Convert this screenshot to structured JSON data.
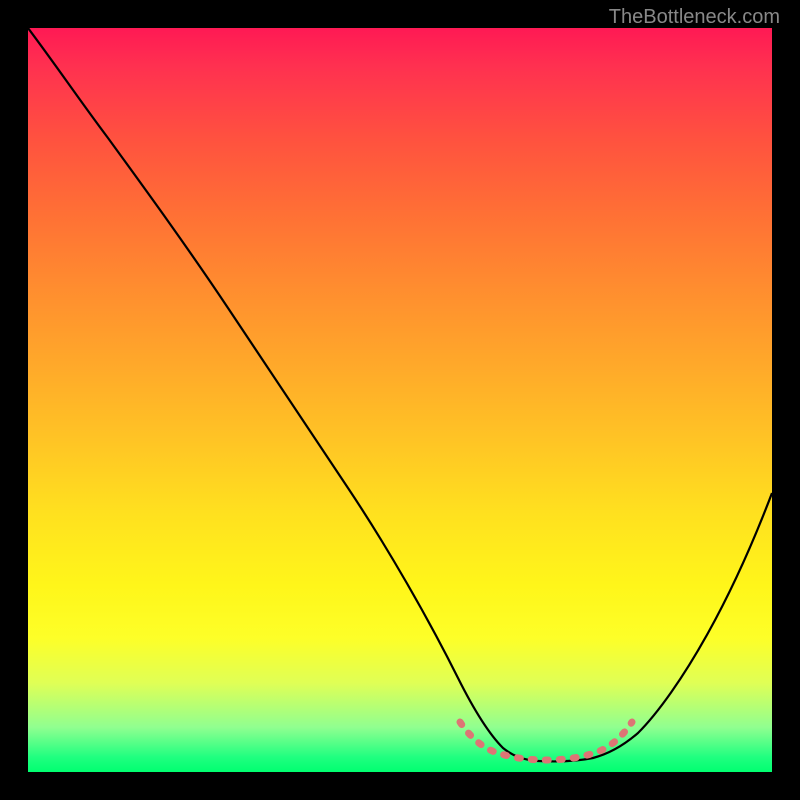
{
  "watermark": "TheBottleneck.com",
  "chart_data": {
    "type": "line",
    "title": "",
    "xlabel": "",
    "ylabel": "",
    "xlim": [
      0,
      100
    ],
    "ylim": [
      0,
      100
    ],
    "background_gradient": {
      "top_color": "#ff1954",
      "bottom_color": "#00ff70",
      "description": "red to green vertical gradient"
    },
    "series": [
      {
        "name": "bottleneck-curve",
        "color": "#000000",
        "x": [
          0,
          5,
          10,
          15,
          20,
          25,
          30,
          35,
          40,
          45,
          50,
          55,
          58,
          60,
          63,
          66,
          70,
          74,
          78,
          82,
          86,
          90,
          95,
          100
        ],
        "y": [
          100,
          94,
          88,
          82,
          76,
          69,
          62,
          55,
          48,
          40,
          32,
          22,
          14,
          8,
          4,
          2,
          1,
          1,
          2,
          4,
          9,
          16,
          26,
          40
        ]
      },
      {
        "name": "optimal-range-marker",
        "color": "#d87070",
        "x": [
          58,
          60,
          63,
          66,
          70,
          74,
          78,
          80
        ],
        "y": [
          5,
          3,
          2,
          2,
          2,
          2,
          3,
          5
        ]
      }
    ],
    "optimal_range": {
      "start_x": 58,
      "end_x": 80,
      "description": "dotted/dashed reddish marker near curve minimum"
    }
  }
}
